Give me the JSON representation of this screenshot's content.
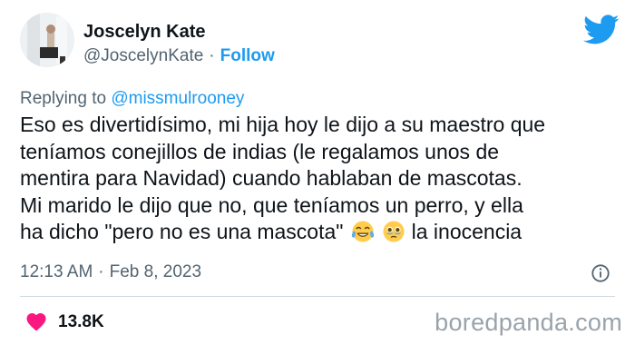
{
  "author": {
    "name": "Joscelyn Kate",
    "handle": "@JoscelynKate",
    "separator": "·",
    "follow_label": "Follow"
  },
  "reply": {
    "prefix": "Replying to ",
    "mention": "@missmulrooney"
  },
  "tweet": {
    "lines": [
      "Eso es divertidísimo, mi hija hoy le dijo a su maestro que",
      "teníamos conejillos de indias (le regalamos unos de",
      "mentira para Navidad) cuando hablaban de mascotas.",
      "Mi marido le dijo que no, que teníamos un perro, y ella",
      "ha dicho \"pero no es una mascota\"",
      "la inocencia"
    ],
    "emojis": [
      "tears-of-joy-emoji",
      "holding-back-tears-emoji"
    ]
  },
  "meta": {
    "time": "12:13 AM",
    "separator": "·",
    "date": "Feb 8, 2023"
  },
  "stats": {
    "likes": "13.8K"
  },
  "watermark": "boredpanda.com",
  "colors": {
    "accent": "#1d9bf0",
    "heart": "#f91880",
    "secondary_text": "#536471"
  }
}
